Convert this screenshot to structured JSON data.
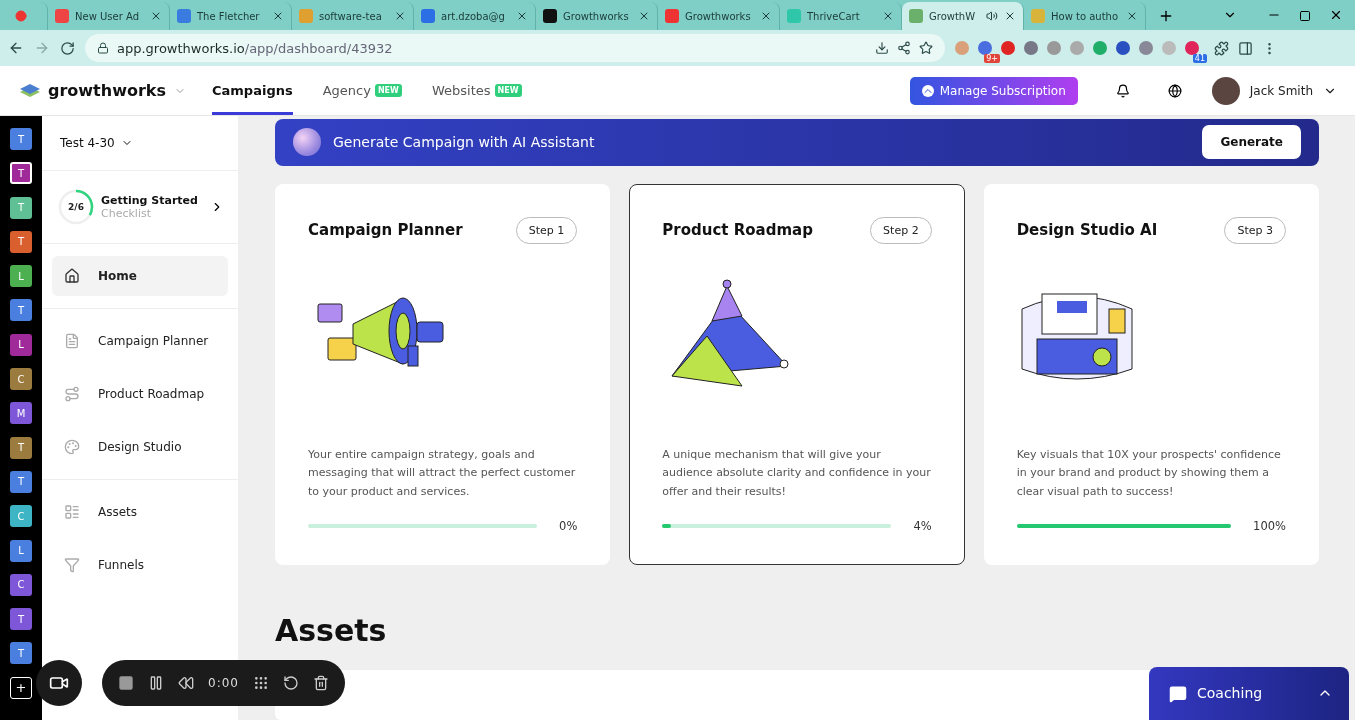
{
  "browser": {
    "tabs": [
      {
        "selected": false,
        "kind": "record"
      },
      {
        "title": "New User Ad",
        "selected": false,
        "kind": "mail"
      },
      {
        "title": "The Fletcher",
        "selected": false,
        "kind": "calendar"
      },
      {
        "title": "software-tea",
        "selected": false,
        "kind": "chat"
      },
      {
        "title": "art.dzoba@g",
        "selected": false,
        "kind": "inbox"
      },
      {
        "title": "Growthworks",
        "selected": false,
        "kind": "g"
      },
      {
        "title": "Growthworks",
        "selected": false,
        "kind": "sk"
      },
      {
        "title": "ThriveCart",
        "selected": false,
        "kind": "cart"
      },
      {
        "title": "GrowthW",
        "selected": true,
        "kind": "app"
      },
      {
        "title": "How to autho",
        "selected": false,
        "kind": "chart"
      }
    ],
    "url_host": "app.growthworks.io",
    "url_path": "/app/dashboard/43932",
    "badges": [
      "9+",
      "41"
    ]
  },
  "header": {
    "brand": "growthworks",
    "nav": [
      {
        "label": "Campaigns",
        "selected": true
      },
      {
        "label": "Agency",
        "selected": false,
        "badge": "NEW"
      },
      {
        "label": "Websites",
        "selected": false,
        "badge": "NEW"
      }
    ],
    "subscription_button": "Manage Subscription",
    "user": "Jack Smith"
  },
  "rail": [
    {
      "letter": "T",
      "color": "#4a7fe0",
      "selected": false
    },
    {
      "letter": "T",
      "color": "#a02a9a",
      "selected": true
    },
    {
      "letter": "T",
      "color": "#5fbf95",
      "selected": false
    },
    {
      "letter": "T",
      "color": "#d9602e",
      "selected": false
    },
    {
      "letter": "L",
      "color": "#4caf50",
      "selected": false
    },
    {
      "letter": "T",
      "color": "#4a7fe0",
      "selected": false
    },
    {
      "letter": "L",
      "color": "#a02a9a",
      "selected": false
    },
    {
      "letter": "C",
      "color": "#9c7b3e",
      "selected": false
    },
    {
      "letter": "M",
      "color": "#7e57d9",
      "selected": false
    },
    {
      "letter": "T",
      "color": "#9c7b3e",
      "selected": false
    },
    {
      "letter": "T",
      "color": "#4a7fe0",
      "selected": false
    },
    {
      "letter": "C",
      "color": "#3db5c4",
      "selected": false
    },
    {
      "letter": "L",
      "color": "#4a7fe0",
      "selected": false
    },
    {
      "letter": "C",
      "color": "#7e57d9",
      "selected": false
    },
    {
      "letter": "T",
      "color": "#7e57d9",
      "selected": false
    },
    {
      "letter": "T",
      "color": "#4a7fe0",
      "selected": false
    }
  ],
  "rail_add": "+",
  "sidebar": {
    "workspace": "Test 4-30",
    "checklist": {
      "count": "2/6",
      "level": 0.333,
      "title": "Getting Started",
      "subtitle": "Checklist"
    },
    "groups": [
      [
        {
          "label": "Home",
          "kind": "home",
          "selected": true
        }
      ],
      [
        {
          "label": "Campaign Planner",
          "kind": "doc",
          "selected": false
        },
        {
          "label": "Product Roadmap",
          "kind": "route",
          "selected": false
        },
        {
          "label": "Design Studio",
          "kind": "palette",
          "selected": false
        }
      ],
      [
        {
          "label": "Assets",
          "kind": "assets",
          "selected": false
        },
        {
          "label": "Funnels",
          "kind": "funnel",
          "selected": false
        }
      ]
    ]
  },
  "banner": {
    "title": "Generate Campaign with AI Assistant",
    "button": "Generate"
  },
  "cards": [
    {
      "title": "Campaign Planner",
      "step": "Step 1",
      "description": "Your entire campaign strategy, goals and messaging that will attract the perfect customer to your product and services.",
      "percent": "0%",
      "selected": false
    },
    {
      "title": "Product Roadmap",
      "step": "Step 2",
      "description": "A unique mechanism that will give your audience absolute clarity and confidence in your offer and their results!",
      "level": 0.04,
      "percent": "4%",
      "selected": true
    },
    {
      "title": "Design Studio AI",
      "step": "Step 3",
      "description": "Key visuals that 10X your prospects' confidence in your brand and product by showing them a clear visual path to success!",
      "level": 1,
      "percent": "100%",
      "selected": false
    }
  ],
  "assets_heading": "Assets",
  "recorder": {
    "time": "0:00"
  },
  "coaching": {
    "label": "Coaching"
  }
}
